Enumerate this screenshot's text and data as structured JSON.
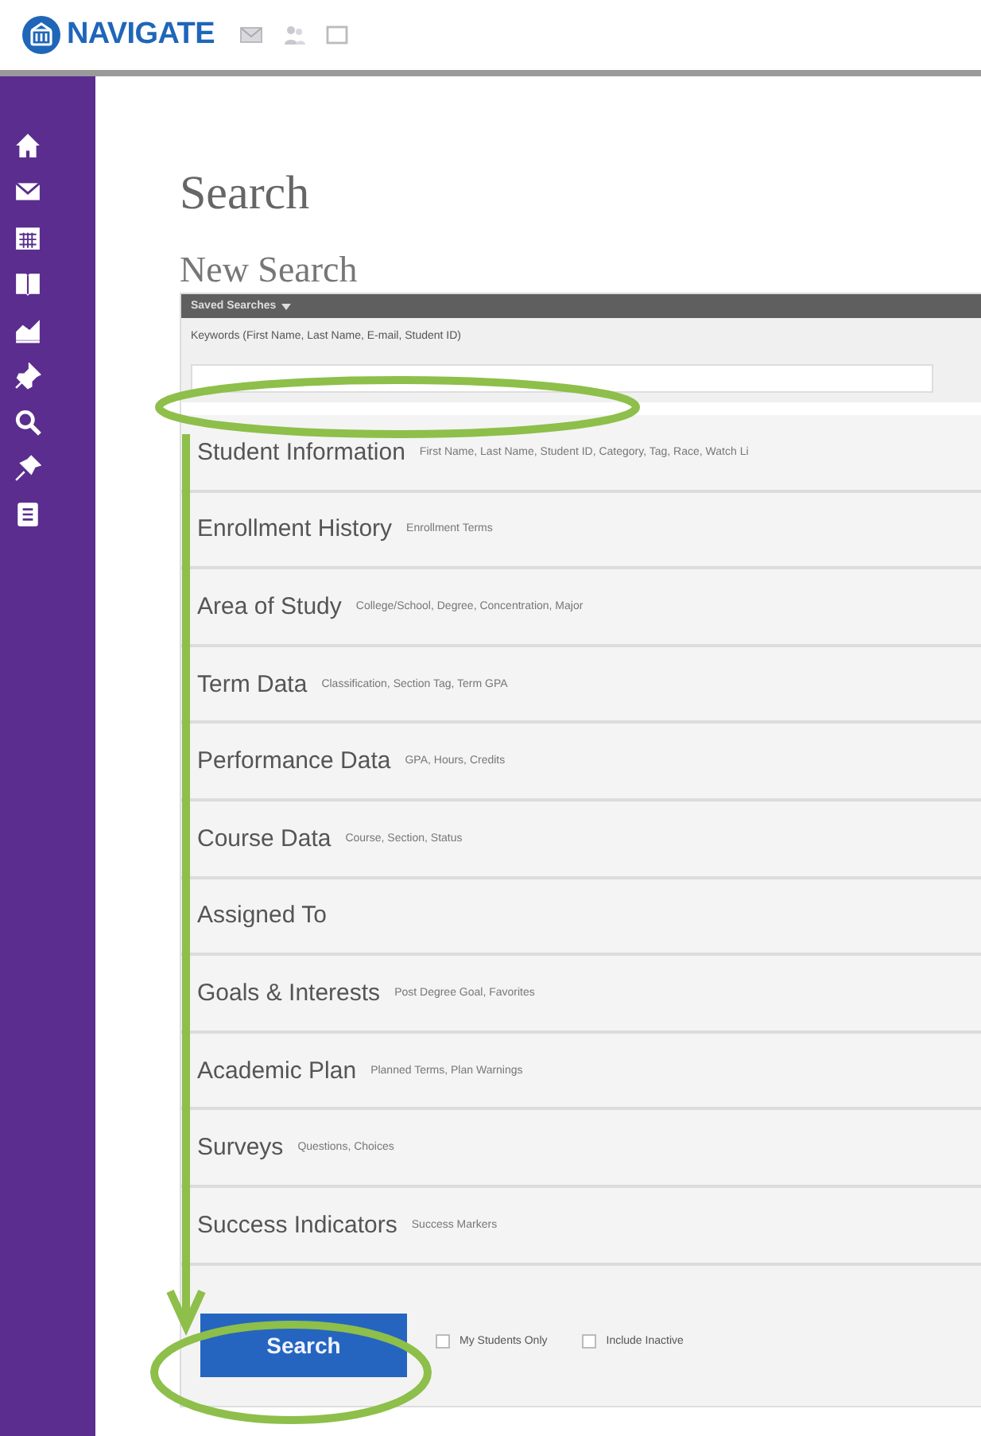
{
  "header": {
    "logo": "NAVIGATE"
  },
  "page_title": "Search",
  "section_title": "New Search",
  "saved_searches": {
    "label": "Saved Searches"
  },
  "keywords": {
    "label": "Keywords (First Name, Last Name, E-mail, Student ID)"
  },
  "categories": [
    {
      "title": "Student Information",
      "fields": "First Name, Last Name, Student ID, Category, Tag, Race, Watch Li"
    },
    {
      "title": "Enrollment History",
      "fields": "Enrollment Terms"
    },
    {
      "title": "Area of Study",
      "fields": "College/School, Degree, Concentration, Major"
    },
    {
      "title": "Term Data",
      "fields": "Classification, Section Tag, Term GPA"
    },
    {
      "title": "Performance Data",
      "fields": "GPA, Hours, Credits"
    },
    {
      "title": "Course Data",
      "fields": "Course, Section, Status"
    },
    {
      "title": "Assigned To"
    },
    {
      "title": "Goals & Interests",
      "fields": "Post Degree Goal, Favorites"
    },
    {
      "title": "Academic Plan",
      "fields": "Planned Terms, Plan Warnings"
    },
    {
      "title": "Surveys",
      "fields": "Questions, Choices"
    },
    {
      "title": "Success Indicators",
      "fields": "Success Markers"
    }
  ],
  "search_button": {
    "label": "Search"
  },
  "options": [
    {
      "label": "My Students Only",
      "checked": false
    },
    {
      "label": "Include Inactive",
      "checked": false
    }
  ]
}
